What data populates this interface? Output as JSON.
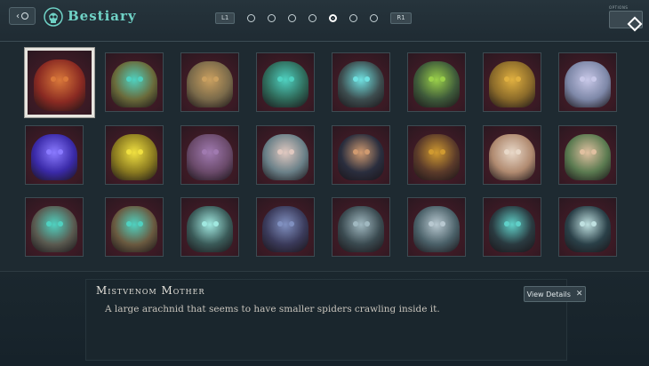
{
  "header": {
    "title": "Bestiary",
    "back_icon": "back-arrow-icon",
    "left_shoulder": "L1",
    "right_shoulder": "R1",
    "options_label": "OPTIONS"
  },
  "pager": {
    "pages": 7,
    "current_page": 5
  },
  "grid": {
    "selected_index": 0,
    "rows": 3,
    "cols": 8,
    "portraits": [
      {
        "name": "Mistvenom Mother",
        "color": "#8a2a22",
        "accent": "#d9783a"
      },
      {
        "name": "",
        "color": "#6a6a3a",
        "accent": "#4fd1c0"
      },
      {
        "name": "",
        "color": "#7a6a4a",
        "accent": "#caa060"
      },
      {
        "name": "",
        "color": "#2f6a5a",
        "accent": "#4fd1c0"
      },
      {
        "name": "",
        "color": "#3d4d4f",
        "accent": "#6fe0e0"
      },
      {
        "name": "",
        "color": "#3e5a3a",
        "accent": "#9ad04a"
      },
      {
        "name": "",
        "color": "#8a6a2a",
        "accent": "#e0b040"
      },
      {
        "name": "",
        "color": "#7e88a8",
        "accent": "#c8c8e8"
      },
      {
        "name": "",
        "color": "#3a2aa8",
        "accent": "#8a7aff"
      },
      {
        "name": "",
        "color": "#8a7a20",
        "accent": "#f0e040"
      },
      {
        "name": "",
        "color": "#6a4a6a",
        "accent": "#a07ab0"
      },
      {
        "name": "",
        "color": "#6a8088",
        "accent": "#e0c8c0"
      },
      {
        "name": "",
        "color": "#2a2e3e",
        "accent": "#d09a70"
      },
      {
        "name": "",
        "color": "#5a3a2a",
        "accent": "#d09a30"
      },
      {
        "name": "",
        "color": "#b08a70",
        "accent": "#e8d8c8"
      },
      {
        "name": "",
        "color": "#5a7a50",
        "accent": "#e0c0a0"
      },
      {
        "name": "",
        "color": "#5a5a50",
        "accent": "#4fd1c0"
      },
      {
        "name": "",
        "color": "#6a5a40",
        "accent": "#4fd1c0"
      },
      {
        "name": "",
        "color": "#3a5a58",
        "accent": "#a0e8e0"
      },
      {
        "name": "",
        "color": "#3a3a5a",
        "accent": "#8090c0"
      },
      {
        "name": "",
        "color": "#3a4a50",
        "accent": "#a0b8c0"
      },
      {
        "name": "",
        "color": "#4a6068",
        "accent": "#b8c8d0"
      },
      {
        "name": "",
        "color": "#2a3a40",
        "accent": "#5fd0c8"
      },
      {
        "name": "",
        "color": "#2a4048",
        "accent": "#bfe0e0"
      }
    ]
  },
  "detail": {
    "name": "Mistvenom Mother",
    "description": "A large arachnid that seems to have smaller spiders crawling inside it.",
    "view_details_label": "View Details"
  },
  "colors": {
    "accent": "#6fd2c6",
    "panel": "#1e2a31"
  }
}
